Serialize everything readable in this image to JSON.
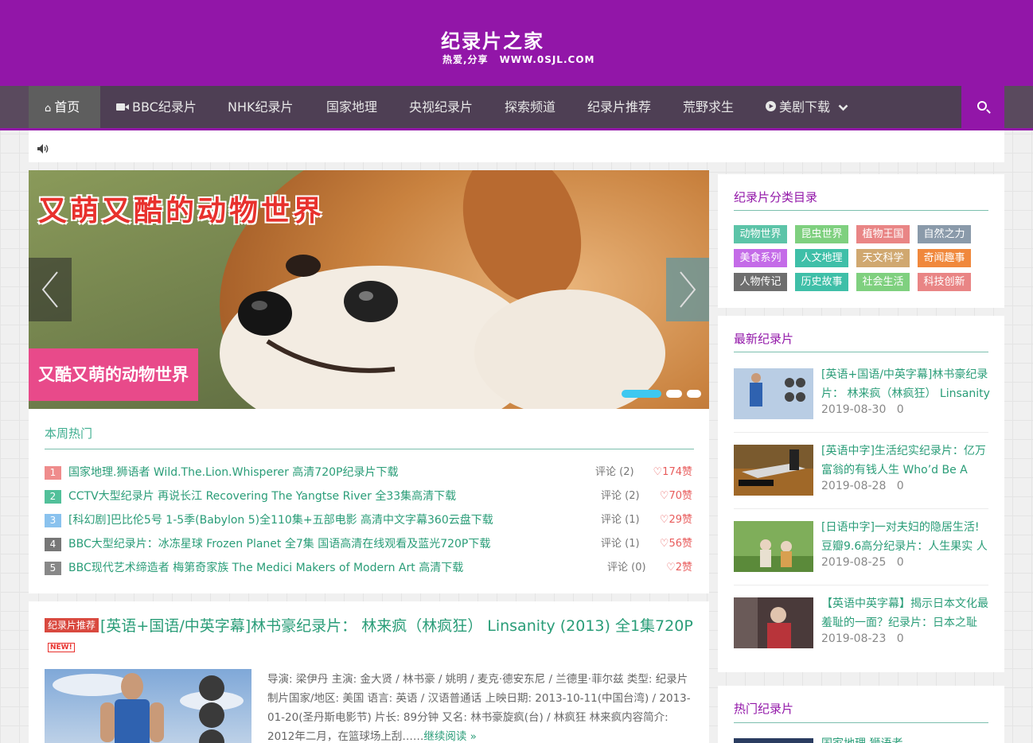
{
  "site": {
    "title": "纪录片之家",
    "tagline": "热爱,分享",
    "domain": "WWW.0SJL.COM",
    "brand_color": "#9216a8"
  },
  "nav": {
    "items": [
      {
        "label": "首页",
        "icon": "home-icon"
      },
      {
        "label": "BBC纪录片",
        "icon": "video-camera-icon"
      },
      {
        "label": "NHK纪录片"
      },
      {
        "label": "国家地理"
      },
      {
        "label": "央视纪录片"
      },
      {
        "label": "探索频道"
      },
      {
        "label": "纪录片推荐"
      },
      {
        "label": "荒野求生"
      },
      {
        "label": "美剧下载",
        "icon": "play-circle-icon",
        "dropdown": "chevron-down-icon"
      }
    ],
    "search_icon": "search-icon"
  },
  "notice": {
    "icon": "speaker-icon"
  },
  "slider": {
    "headline": "又萌又酷的动物世界",
    "caption": "又酷又萌的动物世界",
    "prev_icon": "chevron-left-icon",
    "next_icon": "chevron-right-icon"
  },
  "weekly": {
    "title": "本周热门",
    "items": [
      {
        "rank": "1",
        "title": "国家地理.狮语者 Wild.The.Lion.Whisperer 高清720P纪录片下载",
        "comments": "评论 (2)",
        "likes": "♡174赞",
        "color": "#ef8c8c"
      },
      {
        "rank": "2",
        "title": "CCTV大型纪录片 再说长江 Recovering The Yangtse River 全33集高清下载",
        "comments": "评论 (2)",
        "likes": "♡70赞",
        "color": "#52c09a"
      },
      {
        "rank": "3",
        "title": "[科幻剧]巴比伦5号 1-5季(Babylon 5)全110集+五部电影 高清中文字幕360云盘下载",
        "comments": "评论 (1)",
        "likes": "♡29赞",
        "color": "#8ac2ee"
      },
      {
        "rank": "4",
        "title": "BBC大型纪录片：冰冻星球 Frozen Planet 全7集 国语高清在线观看及蓝光720P下载",
        "comments": "评论 (1)",
        "likes": "♡56赞",
        "color": "#777777"
      },
      {
        "rank": "5",
        "title": "BBC现代艺术缔造者 梅第奇家族 The Medici Makers of Modern Art 高清下载",
        "comments": "评论 (0)",
        "likes": "♡2赞",
        "color": "#888888"
      }
    ]
  },
  "post": {
    "badge": "纪录片推荐",
    "title": "[英语+国语/中英字幕]林书豪纪录片： 林来疯（林疯狂） Linsanity (2013) 全1集720P",
    "new_badge": "NEW!",
    "excerpt": "导演: 梁伊丹 主演: 金大贤 / 林书豪 / 姚明 / 麦克·德安东尼 / 兰德里·菲尔兹 类型: 纪录片 制片国家/地区: 美国 语言: 英语 / 汉语普通话 上映日期: 2013-10-11(中国台湾) / 2013-01-20(圣丹斯电影节) 片长: 89分钟 又名: 林书豪旋疯(台) / 林疯狂 林来疯内容简介:　　2012年二月，在篮球场上刮……",
    "read_more": "继续阅读 »"
  },
  "categories": {
    "title": "纪录片分类目录",
    "tags": [
      {
        "label": "动物世界",
        "color": "#5cc4a8"
      },
      {
        "label": "昆虫世界",
        "color": "#7fd07f"
      },
      {
        "label": "植物王国",
        "color": "#e98585"
      },
      {
        "label": "自然之力",
        "color": "#8a9aaa"
      },
      {
        "label": "美食系列",
        "color": "#c46be8"
      },
      {
        "label": "人文地理",
        "color": "#3fbfa8"
      },
      {
        "label": "天文科学",
        "color": "#d0a870"
      },
      {
        "label": "奇闻趣事",
        "color": "#f0883c"
      },
      {
        "label": "人物传记",
        "color": "#6e6e6e"
      },
      {
        "label": "历史故事",
        "color": "#3fbfa8"
      },
      {
        "label": "社会生活",
        "color": "#7fd07f"
      },
      {
        "label": "科技创新",
        "color": "#e98585"
      }
    ]
  },
  "latest": {
    "title": "最新纪录片",
    "items": [
      {
        "title": "[英语+国语/中英字幕]林书豪纪录片： 林来疯（林疯狂） Linsanity",
        "date": "2019-08-30",
        "count": "0"
      },
      {
        "title": "[英语中字]生活纪实纪录片：亿万富翁的有钱人生 Who’d Be A",
        "date": "2019-08-28",
        "count": "0"
      },
      {
        "title": "[日语中字]一对夫妇的隐居生活! 豆瓣9.6高分纪录片：人生果实 人",
        "date": "2019-08-25",
        "count": "0"
      },
      {
        "title": "【英语中英字幕】揭示日本文化最羞耻的一面？纪录片：日本之耻",
        "date": "2019-08-23",
        "count": "0"
      }
    ]
  },
  "popular": {
    "title": "热门纪录片",
    "first_item": "国家地理.狮语者"
  }
}
